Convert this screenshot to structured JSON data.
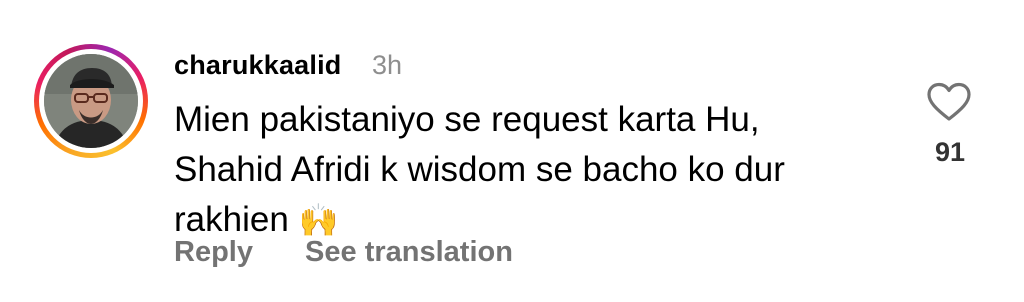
{
  "comment": {
    "username": "charukkaalid",
    "time": "3h",
    "text_lines": [
      "Mien pakistaniyo se request karta Hu,",
      "Shahid Afridi k wisdom se bacho ko dur",
      "rakhien"
    ],
    "emoji": "🙌",
    "likes": "91"
  },
  "actions": {
    "reply_label": "Reply",
    "translate_label": "See translation"
  },
  "icons": {
    "like": "heart-outline-icon",
    "emoji": "raising-hands-emoji"
  },
  "colors": {
    "meta_text": "#8e8e8e",
    "action_text": "#737373",
    "story_ring_start": "#f9a825",
    "story_ring_end": "#c2185b"
  }
}
